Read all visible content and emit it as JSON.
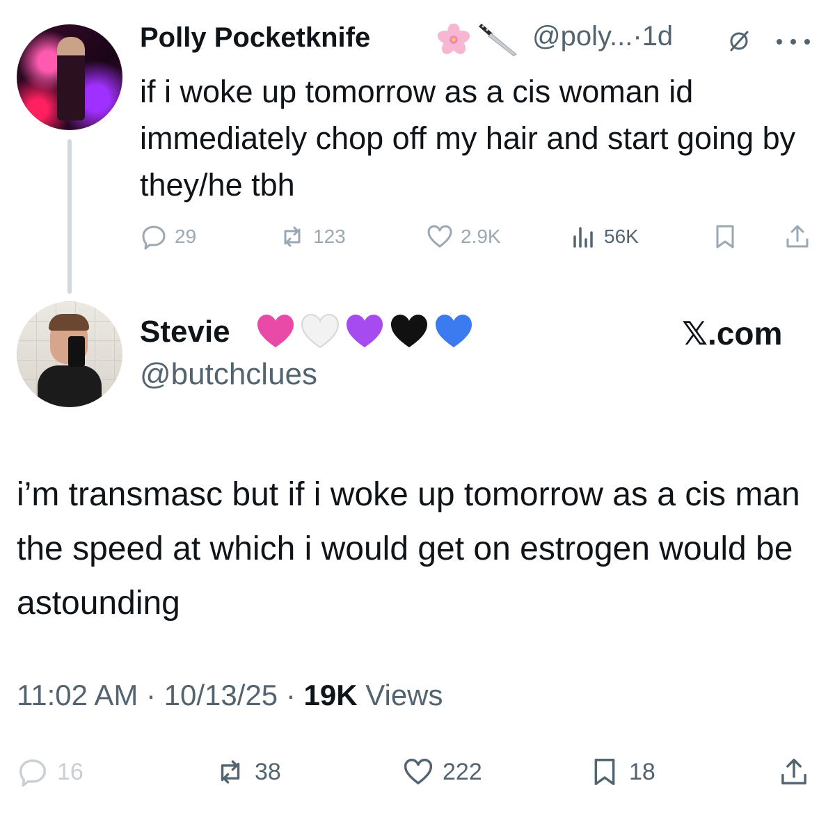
{
  "tweet1": {
    "author_name": "Polly Pocketknife",
    "author_emojis": [
      "cherry-blossom",
      "kitchen-knife"
    ],
    "handle": "@poly...",
    "separator": "·",
    "time": "1d",
    "text": "if i woke up tomorrow as a cis woman id immediately chop off my hair and start going by they/he tbh",
    "actions": {
      "replies": "29",
      "reposts": "123",
      "likes": "2.9K",
      "views": "56K"
    }
  },
  "tweet2": {
    "author_name": "Stevie",
    "author_hearts": [
      "#e94aa8",
      "#f2f2f2",
      "#a64bf0",
      "#111111",
      "#3b7bef"
    ],
    "handle": "@butchclues",
    "brand": "𝕏.com",
    "text": "i’m transmasc but if i woke up tomorrow as a cis man the speed at which i would get on estrogen would be astounding",
    "time": "11:02 AM",
    "date": "10/13/25",
    "views_count": "19K",
    "views_label": "Views",
    "sep": " · ",
    "actions": {
      "replies": "16",
      "reposts": "38",
      "likes": "222",
      "bookmarks": "18"
    }
  },
  "colors": {
    "text_primary": "#0f1419",
    "text_secondary": "#536471",
    "icon_faded": "#9aa8b3",
    "thread_line": "#cfd9de"
  }
}
